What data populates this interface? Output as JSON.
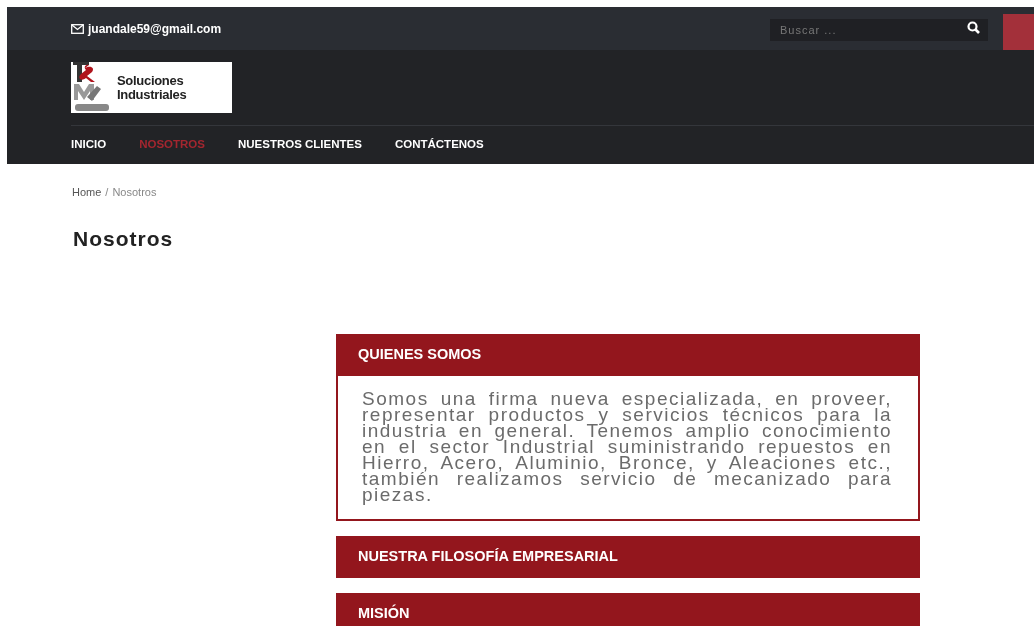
{
  "topbar": {
    "email": "juandale59@gmail.com",
    "search": {
      "placeholder": "Buscar ..."
    }
  },
  "logo": {
    "line_1": "Soluciones",
    "line_2": "Industriales"
  },
  "nav": [
    {
      "label": "INICIO",
      "selected": false
    },
    {
      "label": "NOSOTROS",
      "selected": true
    },
    {
      "label": "NUESTROS CLIENTES",
      "selected": false
    },
    {
      "label": "CONTÁCTENOS",
      "selected": false
    }
  ],
  "breadcrumb": {
    "items": [
      "Home",
      "Nosotros"
    ],
    "separator": "/"
  },
  "page_title": "Nosotros",
  "accordion": [
    {
      "title": "QUIENES SOMOS",
      "expanded": true,
      "body": "Somos una firma nueva especializada, en proveer, representar productos y servicios técnicos para la industria en general. Tenemos amplio conocimiento en el sector Industrial suministrando repuestos en Hierro, Acero, Aluminio, Bronce, y Aleaciones etc., también realizamos servicio de mecanizado para piezas."
    },
    {
      "title": "NUESTRA FILOSOFÍA EMPRESARIAL",
      "expanded": false
    },
    {
      "title": "MISIÓN",
      "expanded": false
    }
  ]
}
